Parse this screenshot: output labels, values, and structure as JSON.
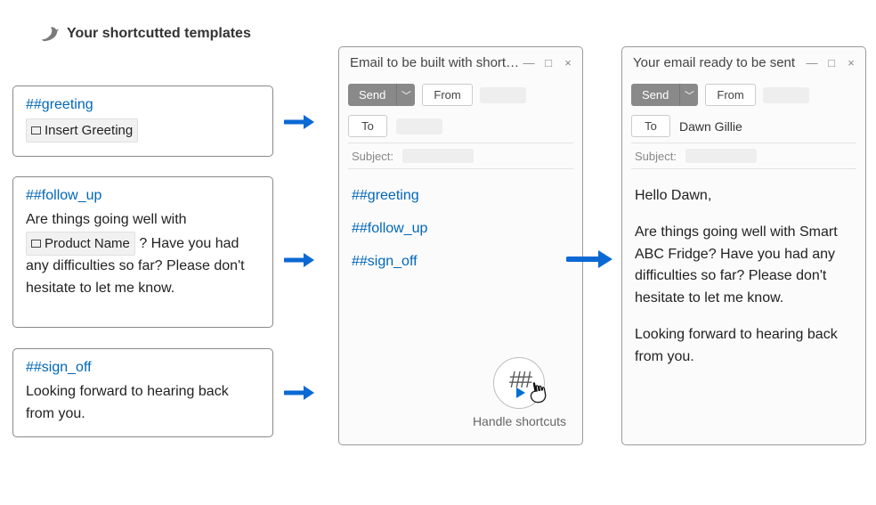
{
  "templates_heading": "Your shortcutted templates",
  "templates": {
    "greeting": {
      "tag": "##greeting",
      "chip": "Insert Greeting"
    },
    "follow_up": {
      "tag": "##follow_up",
      "body_before": "Are things going well with ",
      "chip": "Product Name",
      "body_after": "? Have you had any difficulties so far? Please don't hesitate to let me know."
    },
    "sign_off": {
      "tag": "##sign_off",
      "body": "Looking forward to hearing back from you."
    }
  },
  "compose_window": {
    "title": "Email to be built with shortcuts",
    "send_label": "Send",
    "from_label": "From",
    "to_label": "To",
    "subject_label": "Subject:",
    "body_shortcuts": {
      "s1": "##greeting",
      "s2": "##follow_up",
      "s3": "##sign_off"
    },
    "handle_label": "Handle shortcuts",
    "handle_symbol": "##"
  },
  "result_window": {
    "title": "Your email ready to be sent",
    "send_label": "Send",
    "from_label": "From",
    "to_label": "To",
    "to_value": "Dawn Gillie",
    "subject_label": "Subject:",
    "body": {
      "p1": "Hello Dawn,",
      "p2": "Are things going well with Smart ABC Fridge? Have you had any difficulties so far? Please don't hesitate to let me know.",
      "p3": "Looking forward to hearing back from you."
    }
  },
  "window_controls": {
    "min": "—",
    "max": "□",
    "close": "×"
  }
}
